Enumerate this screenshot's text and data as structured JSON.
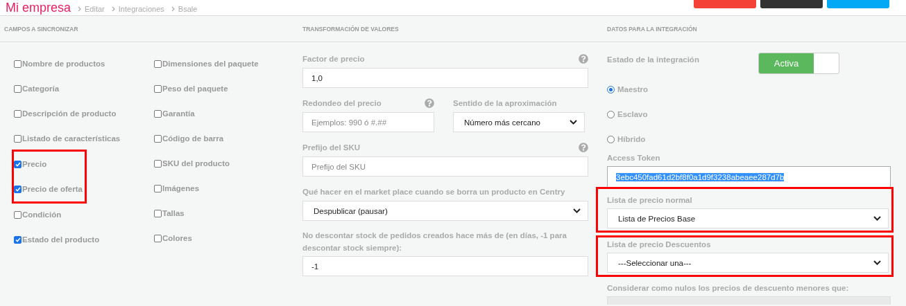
{
  "header": {
    "title": "Mi empresa",
    "breadcrumbs": [
      "Editar",
      "Integraciones",
      "Bsale"
    ],
    "buttons": [
      {
        "color": "#f44336"
      },
      {
        "color": "#333333"
      },
      {
        "color": "#03a9f4"
      }
    ]
  },
  "sync_fields": {
    "title": "CAMPOS A SINCRONIZAR",
    "columns": [
      [
        {
          "label": "Nombre de productos",
          "checked": false,
          "highlighted": false
        },
        {
          "label": "Categoría",
          "checked": false,
          "highlighted": false
        },
        {
          "label": "Descripción de producto",
          "checked": false,
          "highlighted": false
        },
        {
          "label": "Listado de características",
          "checked": false,
          "highlighted": false
        },
        {
          "label": "Precio",
          "checked": true,
          "highlighted": true
        },
        {
          "label": "Precio de oferta",
          "checked": true,
          "highlighted": true
        },
        {
          "label": "Condición",
          "checked": false,
          "highlighted": false
        },
        {
          "label": "Estado del producto",
          "checked": true,
          "highlighted": false
        }
      ],
      [
        {
          "label": "Dimensiones del paquete",
          "checked": false,
          "highlighted": false
        },
        {
          "label": "Peso del paquete",
          "checked": false,
          "highlighted": false
        },
        {
          "label": "Garantía",
          "checked": false,
          "highlighted": false
        },
        {
          "label": "Código de barra",
          "checked": false,
          "highlighted": false
        },
        {
          "label": "SKU del producto",
          "checked": false,
          "highlighted": false
        },
        {
          "label": "Imágenes",
          "checked": false,
          "highlighted": false
        },
        {
          "label": "Tallas",
          "checked": false,
          "highlighted": false
        },
        {
          "label": "Colores",
          "checked": false,
          "highlighted": false
        }
      ]
    ]
  },
  "transform": {
    "title": "TRANSFORMACIÓN DE VALORES",
    "price_factor": {
      "label": "Factor de precio",
      "value": "1,0"
    },
    "rounding": {
      "label": "Redondeo del precio",
      "placeholder": "Ejemplos: 990 ó #.##"
    },
    "direction": {
      "label": "Sentido de la aproximación",
      "value": "Número más cercano"
    },
    "sku_prefix": {
      "label": "Prefijo del SKU",
      "placeholder": "Prefijo del SKU"
    },
    "on_delete": {
      "label": "Qué hacer en el market place cuando se borra un producto en Centry",
      "value": "Despublicar (pausar)"
    },
    "stock_days": {
      "label": "No descontar stock de pedidos creados hace más de (en días, -1 para descontar stock siempre):",
      "value": "-1"
    }
  },
  "integration": {
    "title": "DATOS PARA LA INTEGRACIÓN",
    "status": {
      "label": "Estado de la integración",
      "text": "Activa",
      "on": true
    },
    "modes": [
      {
        "label": "Maestro",
        "selected": true
      },
      {
        "label": "Esclavo",
        "selected": false
      },
      {
        "label": "Híbrido",
        "selected": false
      }
    ],
    "token": {
      "label": "Access Token",
      "value": "3ebc450fad61d2bf8f0a1d9f3238abeaee287d7b",
      "selected": true
    },
    "normal_list": {
      "label": "Lista de precio normal",
      "value": "Lista de Precios Base",
      "highlighted": true
    },
    "discount_list": {
      "label": "Lista de precio Descuentos",
      "value": "---Seleccionar una---",
      "highlighted": true
    },
    "null_prices": {
      "label": "Considerar como nulos los precios de descuento menores que:"
    }
  }
}
